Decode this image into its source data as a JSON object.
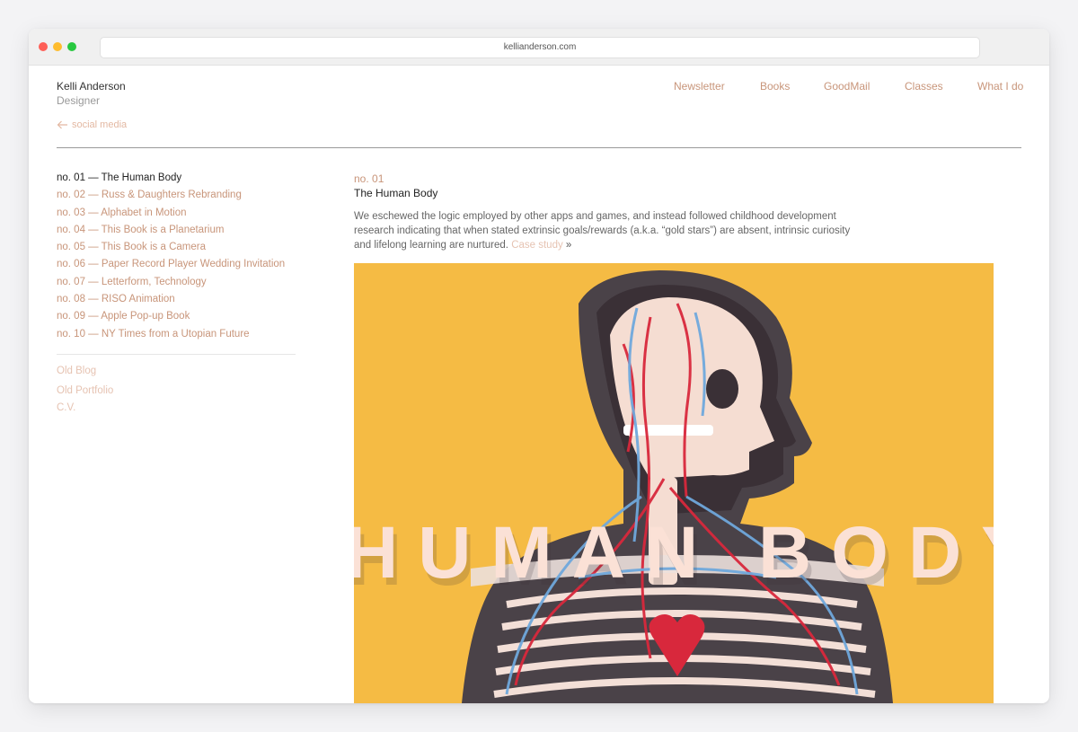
{
  "browser": {
    "url": "kellianderson.com"
  },
  "brand": {
    "name": "Kelli Anderson",
    "role": "Designer"
  },
  "nav": [
    "Newsletter",
    "Books",
    "GoodMail",
    "Classes",
    "What I do"
  ],
  "back_link": "social media",
  "projects": [
    "no. 01 — The Human Body",
    "no. 02 — Russ & Daughters Rebranding",
    "no. 03 — Alphabet in Motion",
    "no. 04 — This Book is a Planetarium",
    "no. 05 — This Book is a Camera",
    "no. 06 — Paper Record Player Wedding Invitation",
    "no. 07 — Letterform, Technology",
    "no. 08 — RISO Animation",
    "no. 09 — Apple Pop-up Book",
    "no. 10 — NY Times from a Utopian Future"
  ],
  "secondary_links": [
    "Old Blog",
    "Old Portfolio",
    "C.V."
  ],
  "project": {
    "number": "no. 01",
    "title": "The Human Body",
    "description": "We eschewed the logic employed by other apps and games, and instead followed childhood development research indicating that when stated extrinsic goals/rewards (a.k.a. “gold stars”) are absent, intrinsic curiosity and lifelong learning are nurtured.",
    "case_study_label": "Case study",
    "case_study_suffix": "»",
    "image_text": "HUMAN BODY"
  },
  "colors": {
    "accent": "#c8957a",
    "accent_light": "#e6c3b2",
    "hero_background": "#f4b73a"
  },
  "icons": {
    "back": "arrow-left-icon"
  }
}
